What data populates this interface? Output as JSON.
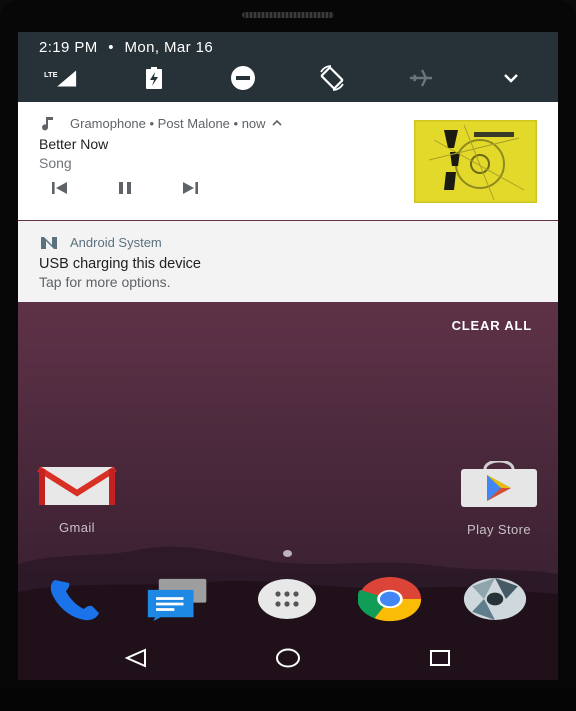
{
  "status": {
    "time": "2:19 PM",
    "separator": "•",
    "date": "Mon, Mar 16"
  },
  "quick_settings": {
    "icons": [
      "lte-signal-icon",
      "battery-charging-icon",
      "do-not-disturb-icon",
      "auto-rotate-icon",
      "airplane-mode-icon",
      "expand-chevron-icon"
    ],
    "lte_label": "LTE"
  },
  "media_notification": {
    "app_icon": "music-note-icon",
    "header": "Gramophone • Post Malone • now",
    "title": "Better Now",
    "subtitle": "Song",
    "controls": [
      "previous-icon",
      "pause-icon",
      "next-icon"
    ]
  },
  "system_notification": {
    "app_icon": "android-n-icon",
    "app_name": "Android System",
    "title": "USB charging this device",
    "subtitle": "Tap for more options."
  },
  "clear_all": "CLEAR ALL",
  "home": {
    "apps": [
      {
        "label": "Gmail",
        "icon": "gmail-icon"
      },
      {
        "label": "Play Store",
        "icon": "play-store-icon"
      }
    ],
    "dock": [
      "phone-icon",
      "messages-icon",
      "app-drawer-icon",
      "chrome-icon",
      "camera-icon"
    ]
  },
  "navigation": [
    "back-icon",
    "home-icon",
    "recents-icon"
  ],
  "colors": {
    "quick_settings_bg": "#263238",
    "wallpaper": "#5c3146",
    "album_yellow": "#dcd42a"
  }
}
